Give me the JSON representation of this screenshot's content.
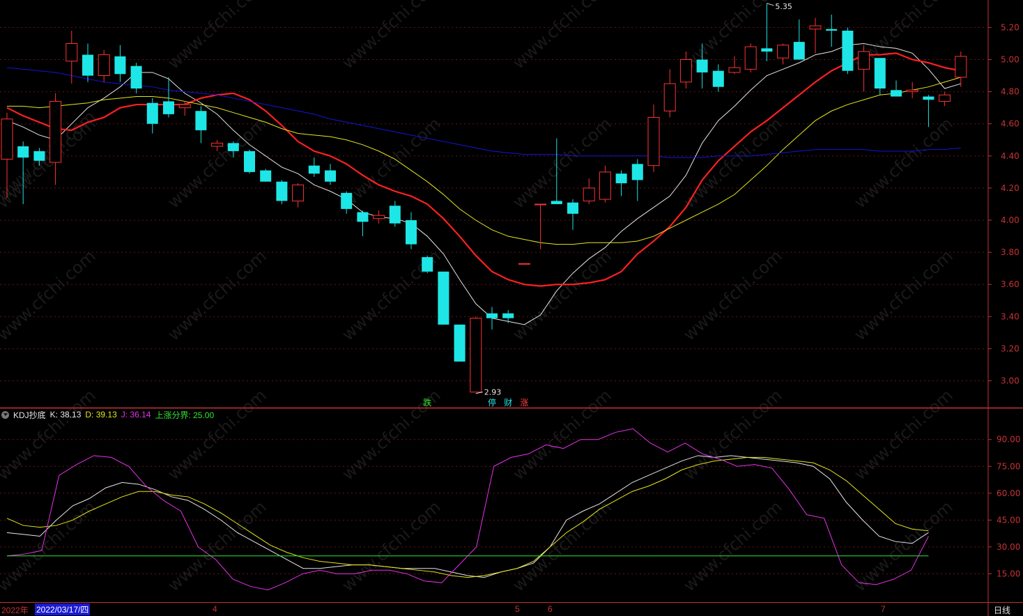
{
  "chart_data": [
    {
      "type": "candlestick",
      "price_ticks": [
        "5.20",
        "5.00",
        "4.80",
        "4.60",
        "4.40",
        "4.20",
        "4.00",
        "3.80",
        "3.60",
        "3.40",
        "3.20",
        "3.00"
      ],
      "ylim": [
        2.85,
        5.4
      ],
      "annotations": {
        "high_label": "5.35",
        "low_label": "2.93"
      },
      "signals": [
        {
          "label": "跌",
          "candle": 26,
          "color": "#32e632"
        },
        {
          "label": "停",
          "candle": 30,
          "color": "#1ee6e6"
        },
        {
          "label": "财",
          "candle": 31,
          "color": "#1ee6e6"
        },
        {
          "label": "涨",
          "candle": 32,
          "color": "#ff4040"
        }
      ],
      "candles": [
        [
          4.38,
          4.63,
          4.14,
          4.67
        ],
        [
          4.46,
          4.39,
          4.1,
          4.49
        ],
        [
          4.43,
          4.37,
          4.34,
          4.45
        ],
        [
          4.36,
          4.74,
          4.22,
          4.79
        ],
        [
          4.99,
          5.1,
          4.85,
          5.18
        ],
        [
          5.03,
          4.9,
          4.86,
          5.1
        ],
        [
          4.9,
          5.03,
          4.86,
          5.06
        ],
        [
          5.02,
          4.91,
          4.86,
          5.09
        ],
        [
          4.96,
          4.82,
          4.79,
          4.98
        ],
        [
          4.73,
          4.6,
          4.54,
          4.76
        ],
        [
          4.74,
          4.66,
          4.64,
          4.89
        ],
        [
          4.7,
          4.72,
          4.65,
          4.74
        ],
        [
          4.68,
          4.56,
          4.48,
          4.71
        ],
        [
          4.46,
          4.48,
          4.43,
          4.5
        ],
        [
          4.48,
          4.43,
          4.39,
          4.49
        ],
        [
          4.43,
          4.3,
          4.29,
          4.44
        ],
        [
          4.31,
          4.24,
          4.24,
          4.32
        ],
        [
          4.24,
          4.12,
          4.1,
          4.25
        ],
        [
          4.12,
          4.22,
          4.08,
          4.23
        ],
        [
          4.34,
          4.29,
          4.27,
          4.39
        ],
        [
          4.31,
          4.24,
          4.22,
          4.35
        ],
        [
          4.17,
          4.07,
          4.04,
          4.18
        ],
        [
          4.05,
          3.99,
          3.9,
          4.06
        ],
        [
          4.01,
          4.03,
          3.98,
          4.06
        ],
        [
          4.09,
          3.98,
          3.96,
          4.12
        ],
        [
          4.0,
          3.85,
          3.82,
          4.05
        ],
        [
          3.77,
          3.68,
          3.67,
          3.78
        ],
        [
          3.68,
          3.35,
          3.35,
          3.68
        ],
        [
          3.35,
          3.12,
          3.12,
          3.35
        ],
        [
          2.93,
          3.39,
          2.93,
          3.4
        ],
        [
          3.42,
          3.39,
          3.32,
          3.46
        ],
        [
          3.42,
          3.39,
          3.36,
          3.44
        ],
        [
          3.73,
          3.73,
          3.73,
          3.73
        ],
        [
          4.1,
          4.1,
          3.82,
          4.1
        ],
        [
          4.12,
          4.1,
          4.1,
          4.51
        ],
        [
          4.11,
          4.04,
          3.94,
          4.13
        ],
        [
          4.12,
          4.2,
          4.1,
          4.26
        ],
        [
          4.13,
          4.3,
          4.11,
          4.34
        ],
        [
          4.29,
          4.23,
          4.15,
          4.31
        ],
        [
          4.35,
          4.25,
          4.12,
          4.38
        ],
        [
          4.34,
          4.64,
          4.3,
          4.72
        ],
        [
          4.68,
          4.85,
          4.64,
          4.94
        ],
        [
          4.86,
          5.0,
          4.82,
          5.05
        ],
        [
          5.0,
          4.92,
          4.82,
          5.1
        ],
        [
          4.93,
          4.83,
          4.8,
          4.97
        ],
        [
          4.92,
          4.95,
          4.91,
          5.02
        ],
        [
          4.94,
          5.08,
          4.92,
          5.1
        ],
        [
          5.07,
          5.05,
          4.99,
          5.35
        ],
        [
          5.01,
          5.09,
          4.97,
          5.1
        ],
        [
          5.11,
          5.0,
          5.0,
          5.25
        ],
        [
          5.19,
          5.21,
          5.04,
          5.26
        ],
        [
          5.19,
          5.18,
          5.08,
          5.28
        ],
        [
          5.18,
          4.93,
          4.91,
          5.2
        ],
        [
          4.94,
          5.05,
          4.8,
          5.09
        ],
        [
          5.01,
          4.82,
          4.78,
          5.01
        ],
        [
          4.81,
          4.77,
          4.77,
          4.87
        ],
        [
          4.8,
          4.81,
          4.76,
          4.86
        ],
        [
          4.77,
          4.75,
          4.58,
          4.78
        ],
        [
          4.74,
          4.78,
          4.71,
          4.8
        ],
        [
          4.89,
          5.02,
          4.83,
          5.05
        ]
      ],
      "ma_series": [
        {
          "color": "#e6e6e6",
          "values": [
            4.62,
            4.58,
            4.53,
            4.5,
            4.6,
            4.7,
            4.76,
            4.83,
            4.92,
            4.92,
            4.88,
            4.79,
            4.73,
            4.66,
            4.56,
            4.47,
            4.4,
            4.33,
            4.29,
            4.22,
            4.18,
            4.13,
            4.05,
            4.02,
            4.01,
            3.98,
            3.9,
            3.79,
            3.63,
            3.48,
            3.39,
            3.37,
            3.35,
            3.41,
            3.56,
            3.67,
            3.76,
            3.83,
            3.93,
            4.01,
            4.08,
            4.15,
            4.28,
            4.48,
            4.62,
            4.71,
            4.81,
            4.9,
            4.94,
            4.98,
            5.03,
            5.05,
            5.09,
            5.1,
            5.08,
            5.07,
            5.04,
            4.94,
            4.82,
            4.85
          ]
        },
        {
          "color": "#ff2020",
          "values": [
            4.7,
            4.65,
            4.61,
            4.57,
            4.56,
            4.61,
            4.64,
            4.7,
            4.72,
            4.72,
            4.72,
            4.72,
            4.76,
            4.78,
            4.79,
            4.75,
            4.68,
            4.59,
            4.49,
            4.43,
            4.4,
            4.35,
            4.28,
            4.22,
            4.18,
            4.15,
            4.1,
            4.01,
            3.9,
            3.78,
            3.68,
            3.63,
            3.6,
            3.59,
            3.6,
            3.6,
            3.61,
            3.63,
            3.68,
            3.79,
            3.87,
            3.96,
            4.08,
            4.25,
            4.37,
            4.46,
            4.55,
            4.62,
            4.7,
            4.78,
            4.86,
            4.93,
            4.98,
            5.03,
            5.03,
            5.04,
            5.0,
            4.98,
            4.95,
            4.93
          ]
        },
        {
          "color": "#e6e61e",
          "values": [
            4.71,
            4.71,
            4.7,
            4.71,
            4.72,
            4.73,
            4.75,
            4.76,
            4.77,
            4.77,
            4.76,
            4.74,
            4.72,
            4.7,
            4.67,
            4.64,
            4.61,
            4.57,
            4.54,
            4.53,
            4.52,
            4.5,
            4.47,
            4.43,
            4.38,
            4.31,
            4.24,
            4.16,
            4.07,
            4.0,
            3.94,
            3.9,
            3.88,
            3.86,
            3.85,
            3.85,
            3.86,
            3.86,
            3.86,
            3.87,
            3.9,
            3.95,
            4.0,
            4.05,
            4.1,
            4.16,
            4.25,
            4.34,
            4.44,
            4.53,
            4.62,
            4.68,
            4.72,
            4.75,
            4.78,
            4.79,
            4.81,
            4.83,
            4.86,
            4.89
          ]
        },
        {
          "color": "#1414dc",
          "values": [
            4.95,
            4.94,
            4.93,
            4.92,
            4.9,
            4.88,
            4.86,
            4.85,
            4.84,
            4.83,
            4.81,
            4.8,
            4.79,
            4.78,
            4.76,
            4.74,
            4.72,
            4.7,
            4.68,
            4.66,
            4.63,
            4.61,
            4.59,
            4.57,
            4.55,
            4.53,
            4.51,
            4.49,
            4.47,
            4.45,
            4.43,
            4.42,
            4.41,
            4.41,
            4.41,
            4.4,
            4.4,
            4.4,
            4.4,
            4.4,
            4.4,
            4.39,
            4.39,
            4.39,
            4.4,
            4.4,
            4.4,
            4.41,
            4.42,
            4.43,
            4.44,
            4.44,
            4.44,
            4.44,
            4.43,
            4.43,
            4.43,
            4.44,
            4.44,
            4.45
          ]
        }
      ]
    },
    {
      "type": "line",
      "name": "KDJ抄底",
      "legend": {
        "name": "KDJ抄底",
        "k": "K: 38.13",
        "d": "D: 39.13",
        "j": "J: 36.14",
        "line": "上涨分界: 25.00"
      },
      "ylim": [
        0,
        100
      ],
      "y_ticks": [
        "90.00",
        "75.00",
        "60.00",
        "45.00",
        "30.00",
        "15.00"
      ],
      "boundary": 25,
      "series": [
        {
          "name": "K",
          "color": "#e6e6e6",
          "values": [
            38,
            37,
            36,
            45,
            53,
            57,
            63,
            66,
            65,
            62,
            58,
            56,
            51,
            45,
            38,
            33,
            28,
            23,
            18,
            18,
            19,
            20,
            20,
            19,
            18,
            18,
            18,
            16,
            14,
            13,
            16,
            18,
            21,
            30,
            45,
            50,
            54,
            60,
            66,
            70,
            74,
            78,
            81,
            80,
            81,
            80,
            79,
            78,
            77,
            75,
            68,
            55,
            45,
            36,
            33,
            32,
            38
          ]
        },
        {
          "name": "D",
          "color": "#e6e61e",
          "values": [
            46,
            42,
            41,
            42,
            45,
            50,
            54,
            58,
            61,
            61,
            59,
            58,
            54,
            49,
            43,
            37,
            31,
            27,
            24,
            22,
            21,
            20,
            20,
            19,
            18,
            17,
            16,
            14,
            13,
            14,
            16,
            18,
            22,
            30,
            38,
            44,
            51,
            56,
            61,
            64,
            68,
            73,
            76,
            78,
            79,
            80,
            80,
            79,
            78,
            77,
            73,
            67,
            59,
            51,
            43,
            40,
            39
          ]
        },
        {
          "name": "J",
          "color": "#e632e6",
          "values": [
            25,
            26,
            28,
            70,
            76,
            81,
            80,
            75,
            64,
            56,
            50,
            30,
            23,
            12,
            8,
            6,
            10,
            15,
            17,
            15,
            15,
            17,
            17,
            15,
            11,
            10,
            20,
            30,
            75,
            80,
            82,
            87,
            85,
            90,
            90,
            94,
            96,
            88,
            83,
            88,
            82,
            79,
            75,
            76,
            74,
            62,
            48,
            46,
            20,
            10,
            9,
            12,
            17,
            36
          ]
        },
        {
          "name": "上涨分界",
          "color": "#32e632",
          "values": [
            25
          ]
        }
      ]
    }
  ],
  "date_axis": {
    "year": "2022年",
    "cursor_date": "2022/03/17/四",
    "months": [
      {
        "label": "4"
      },
      {
        "label": "5"
      },
      {
        "label": "6"
      },
      {
        "label": "7"
      }
    ],
    "period": "日线"
  }
}
